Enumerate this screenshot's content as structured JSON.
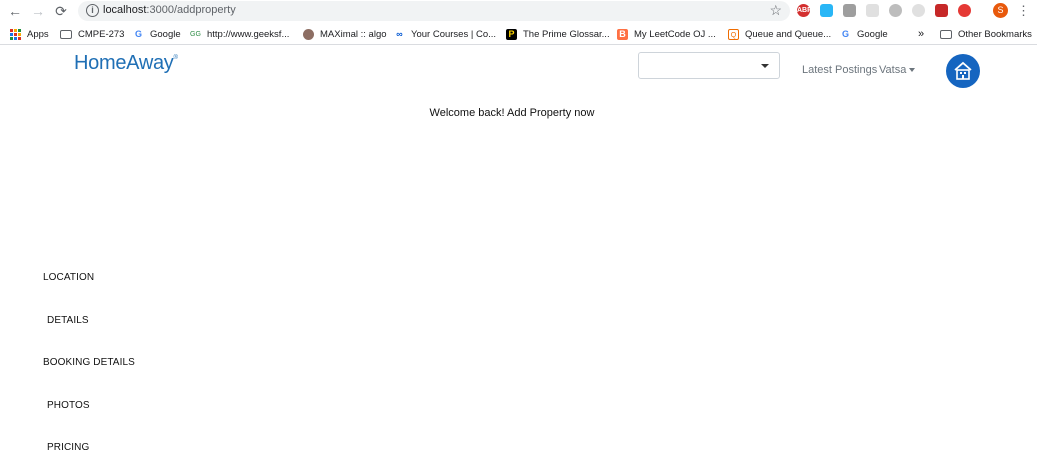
{
  "browser": {
    "url_host": "localhost",
    "url_rest": ":3000/addproperty",
    "profile_initial": "S",
    "extensions": [
      "ABP"
    ],
    "bookmarks": [
      {
        "label": "Apps",
        "icon": "apps-grid-icon"
      },
      {
        "label": "CMPE-273",
        "icon": "folder-icon"
      },
      {
        "label": "Google",
        "icon": "google-g-icon"
      },
      {
        "label": "http://www.geeksf...",
        "icon": "geeksforgeeks-icon"
      },
      {
        "label": "MAXimal :: algo",
        "icon": "maximal-icon"
      },
      {
        "label": "Your Courses | Co...",
        "icon": "coursera-icon"
      },
      {
        "label": "The Prime Glossar...",
        "icon": "prime-icon"
      },
      {
        "label": "My LeetCode OJ ...",
        "icon": "blogger-icon"
      },
      {
        "label": "Queue and Queue...",
        "icon": "queue-icon"
      },
      {
        "label": "Google",
        "icon": "google-g-icon"
      }
    ],
    "overflow_label": "»",
    "other_bookmarks": "Other Bookmarks"
  },
  "header": {
    "logo_text": "HomeAway",
    "logo_mark": "®",
    "select_value": "",
    "latest_postings": "Latest Postings",
    "user_name": "Vatsa"
  },
  "main": {
    "welcome_message": "Welcome back! Add Property now"
  },
  "steps": [
    {
      "label": "LOCATION"
    },
    {
      "label": "DETAILS"
    },
    {
      "label": "BOOKING DETAILS"
    },
    {
      "label": "PHOTOS"
    },
    {
      "label": "PRICING"
    }
  ],
  "colors": {
    "brand": "#1f6fb5",
    "brand_circle": "#1565c0",
    "nav_text": "#6c757d"
  }
}
